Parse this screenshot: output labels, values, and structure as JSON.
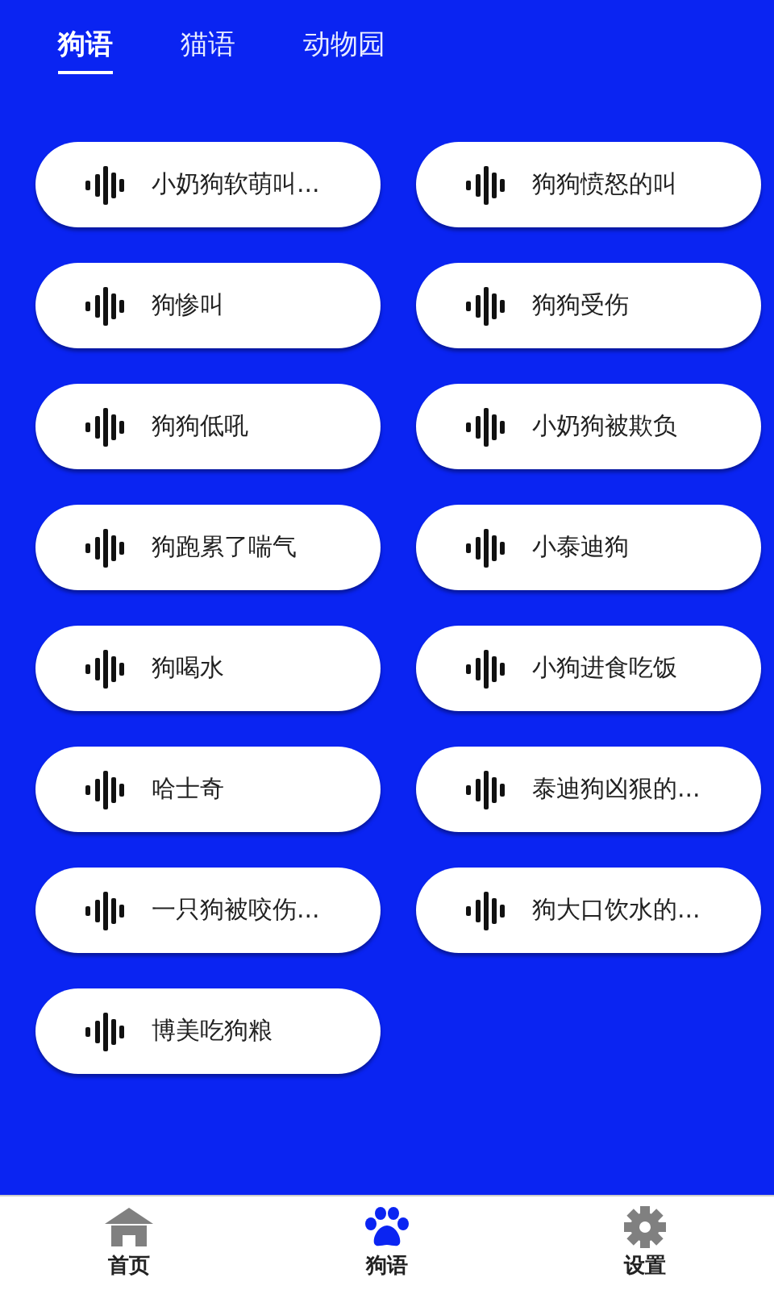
{
  "tabs": [
    {
      "label": "狗语",
      "selected": true
    },
    {
      "label": "猫语",
      "selected": false
    },
    {
      "label": "动物园",
      "selected": false
    }
  ],
  "sounds": [
    {
      "label": "小奶狗软萌叫..."
    },
    {
      "label": "狗狗愤怒的叫"
    },
    {
      "label": "狗惨叫"
    },
    {
      "label": "狗狗受伤"
    },
    {
      "label": "狗狗低吼"
    },
    {
      "label": "小奶狗被欺负"
    },
    {
      "label": "狗跑累了喘气"
    },
    {
      "label": "小泰迪狗"
    },
    {
      "label": "狗喝水"
    },
    {
      "label": "小狗进食吃饭"
    },
    {
      "label": "哈士奇"
    },
    {
      "label": "泰迪狗凶狠的..."
    },
    {
      "label": "一只狗被咬伤..."
    },
    {
      "label": "狗大口饮水的..."
    },
    {
      "label": "博美吃狗粮"
    }
  ],
  "bottom_nav": [
    {
      "label": "首页",
      "kind": "home",
      "selected": false
    },
    {
      "label": "狗语",
      "kind": "paw",
      "selected": true
    },
    {
      "label": "设置",
      "kind": "gear",
      "selected": false
    }
  ]
}
